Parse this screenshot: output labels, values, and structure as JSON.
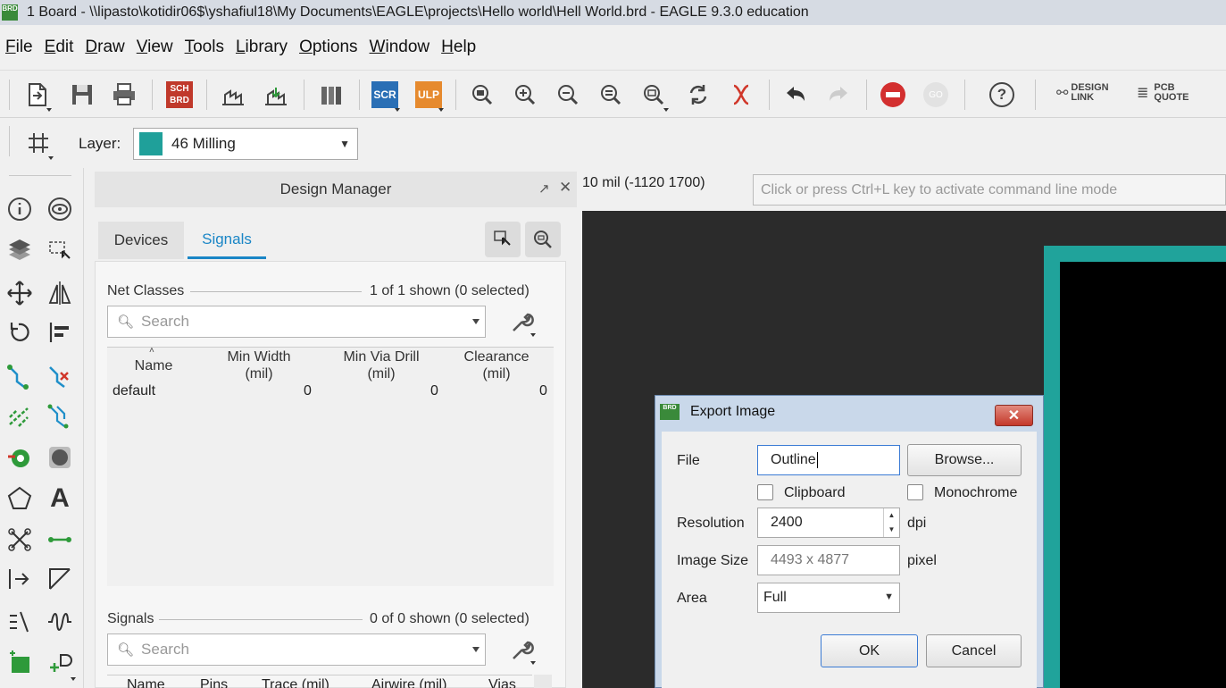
{
  "window": {
    "title": "1 Board - \\\\lipasto\\kotidir06$\\yshafiul18\\My Documents\\EAGLE\\projects\\Hello world\\Hell World.brd - EAGLE 9.3.0 education",
    "icon_text": "BRD"
  },
  "menu": [
    {
      "label": "File"
    },
    {
      "label": "Edit"
    },
    {
      "label": "Draw"
    },
    {
      "label": "View"
    },
    {
      "label": "Tools"
    },
    {
      "label": "Library"
    },
    {
      "label": "Options"
    },
    {
      "label": "Window"
    },
    {
      "label": "Help"
    }
  ],
  "toolbar": {
    "sch_brd_text": "SCH BRD",
    "scr_text": "SCR",
    "ulp_text": "ULP",
    "go_text": "GO",
    "help_text": "?",
    "design_link": "DESIGN LINK",
    "pcb_quote": "PCB QUOTE"
  },
  "layerbar": {
    "label": "Layer:",
    "selected": "46 Milling",
    "swatch_color": "#1fa09a"
  },
  "design_manager": {
    "title": "Design Manager",
    "tabs": [
      {
        "label": "Devices"
      },
      {
        "label": "Signals"
      }
    ],
    "net_classes": {
      "title": "Net Classes",
      "count": "1 of 1 shown (0 selected)",
      "search_placeholder": "Search",
      "columns": [
        "Name",
        "Min Width\n(mil)",
        "Min Via Drill\n(mil)",
        "Clearance\n(mil)"
      ],
      "rows": [
        {
          "name": "default",
          "min_width": "0",
          "min_via_drill": "0",
          "clearance": "0"
        }
      ]
    },
    "signals": {
      "title": "Signals",
      "count": "0 of 0 shown (0 selected)",
      "search_placeholder": "Search",
      "columns": [
        "Name",
        "Pins",
        "Trace (mil)",
        "Airwire (mil)",
        "Vias"
      ]
    }
  },
  "status": {
    "coordinates": "10 mil (-1120 1700)",
    "command_placeholder": "Click or press Ctrl+L key to activate command line mode"
  },
  "export_dialog": {
    "title": "Export Image",
    "file_label": "File",
    "file_value": "Outline",
    "browse_label": "Browse...",
    "clipboard_label": "Clipboard",
    "monochrome_label": "Monochrome",
    "resolution_label": "Resolution",
    "resolution_value": "2400",
    "resolution_unit": "dpi",
    "image_size_label": "Image Size",
    "image_size_value": "4493 x 4877",
    "image_size_unit": "pixel",
    "area_label": "Area",
    "area_value": "Full",
    "ok_label": "OK",
    "cancel_label": "Cancel"
  },
  "colors": {
    "board_outline": "#20a39b",
    "canvas_bg": "#2b2b2b",
    "accent": "#1a86c6"
  }
}
